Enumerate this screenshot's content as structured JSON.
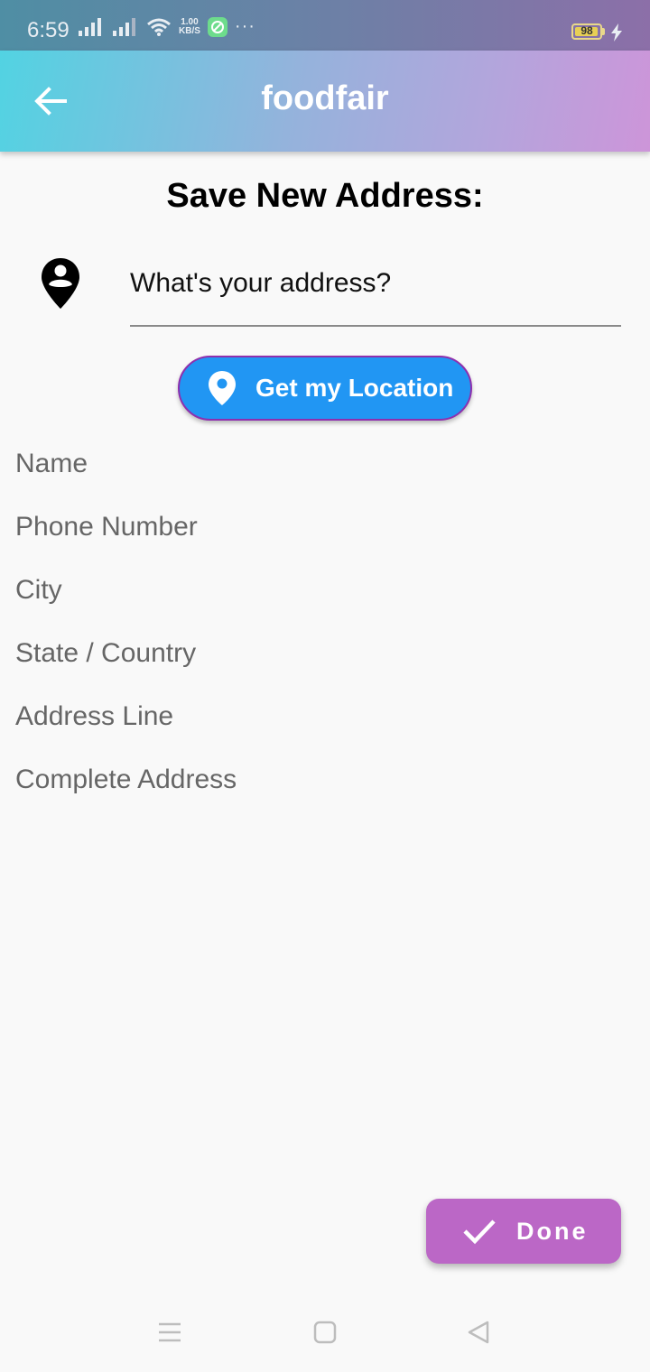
{
  "status_bar": {
    "time": "6:59",
    "net_speed_value": "1.00",
    "net_speed_unit": "KB/S",
    "overflow": "···",
    "battery_level": "98",
    "battery_fraction": 0.98
  },
  "app_bar": {
    "title": "foodfair"
  },
  "page": {
    "heading": "Save New Address:"
  },
  "address_search": {
    "placeholder": "What's your address?",
    "value": ""
  },
  "location_button": {
    "label": "Get my Location"
  },
  "form": {
    "fields": [
      {
        "placeholder": "Name",
        "value": ""
      },
      {
        "placeholder": "Phone Number",
        "value": ""
      },
      {
        "placeholder": "City",
        "value": ""
      },
      {
        "placeholder": "State / Country",
        "value": ""
      },
      {
        "placeholder": "Address Line",
        "value": ""
      },
      {
        "placeholder": "Complete Address",
        "value": ""
      }
    ]
  },
  "done_button": {
    "label": "Done"
  },
  "icons": {
    "back": "arrow-left-icon",
    "address_field": "person-pin-icon",
    "location": "location-pin-icon",
    "done": "check-icon"
  },
  "colors": {
    "app_bar_start": "#52d3e2",
    "app_bar_end": "#cd95d9",
    "location_button": "#2196f3",
    "location_button_border": "#8e2fae",
    "done_button": "#bb67c6"
  }
}
